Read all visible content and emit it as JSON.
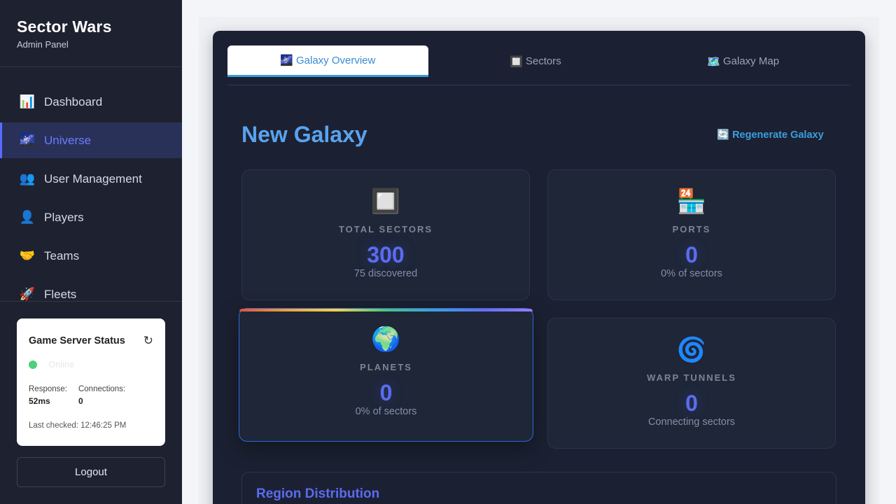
{
  "sidebar": {
    "title": "Sector Wars",
    "subtitle": "Admin Panel",
    "items": [
      {
        "icon": "📊",
        "label": "Dashboard"
      },
      {
        "icon": "🌌",
        "label": "Universe"
      },
      {
        "icon": "👥",
        "label": "User Management"
      },
      {
        "icon": "👤",
        "label": "Players"
      },
      {
        "icon": "🤝",
        "label": "Teams"
      },
      {
        "icon": "🚀",
        "label": "Fleets"
      }
    ],
    "status": {
      "title": "Game Server Status",
      "refresh_icon": "↻",
      "state": "Online",
      "response_label": "Response:",
      "response_value": "52ms",
      "connections_label": "Connections:",
      "connections_value": "0",
      "last_checked": "Last checked: 12:46:25 PM"
    },
    "logout_label": "Logout"
  },
  "tabs": [
    {
      "icon": "🌌",
      "label": "Galaxy Overview"
    },
    {
      "icon": "🔲",
      "label": "Sectors"
    },
    {
      "icon": "🗺️",
      "label": "Galaxy Map"
    }
  ],
  "main": {
    "title": "New Galaxy",
    "regenerate_icon": "🔄",
    "regenerate_label": "Regenerate Galaxy",
    "cards": [
      {
        "icon": "🔲",
        "label": "TOTAL SECTORS",
        "value": "300",
        "sub": "75 discovered"
      },
      {
        "icon": "🏪",
        "label": "PORTS",
        "value": "0",
        "sub": "0% of sectors"
      },
      {
        "icon": "🌍",
        "label": "PLANETS",
        "value": "0",
        "sub": "0% of sectors"
      },
      {
        "icon": "🌀",
        "label": "WARP TUNNELS",
        "value": "0",
        "sub": "Connecting sectors"
      }
    ],
    "region_title": "Region Distribution"
  },
  "colors": {
    "sidebar_bg": "#1e2130",
    "panel_bg": "#1b2132",
    "accent": "#5a6cff",
    "title_blue": "#5aa2ee",
    "online": "#4cd17a"
  }
}
